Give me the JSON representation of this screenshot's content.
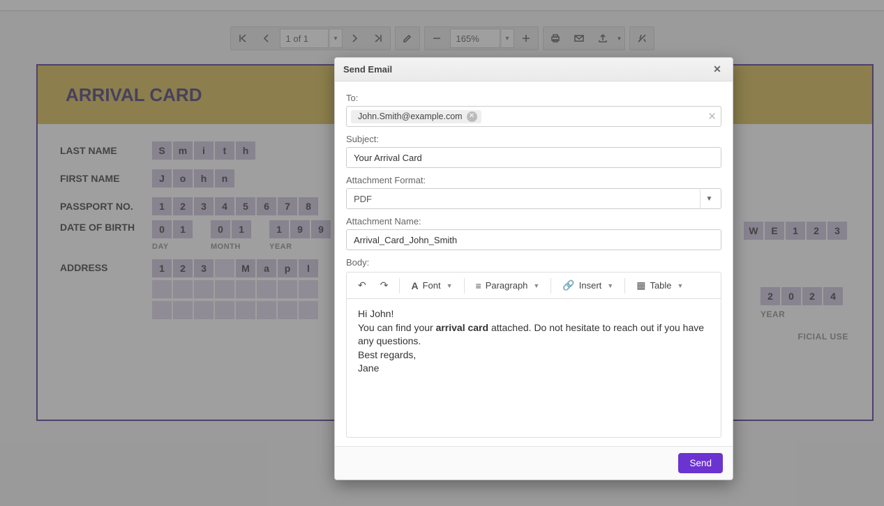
{
  "toolbar": {
    "page_text": "1 of 1",
    "zoom_text": "165%"
  },
  "document": {
    "title": "ARRIVAL CARD",
    "labels": {
      "last_name": "LAST NAME",
      "first_name": "FIRST NAME",
      "passport": "PASSPORT NO.",
      "dob": "DATE OF BIRTH",
      "address": "ADDRESS",
      "day": "DAY",
      "month": "MONTH",
      "year": "YEAR",
      "official": "FICIAL USE"
    },
    "fields": {
      "last_name": [
        "S",
        "m",
        "i",
        "t",
        "h"
      ],
      "first_name": [
        "J",
        "o",
        "h",
        "n"
      ],
      "passport": [
        "1",
        "2",
        "3",
        "4",
        "5",
        "6",
        "7",
        "8"
      ],
      "dob_day": [
        "0",
        "1"
      ],
      "dob_month": [
        "0",
        "1"
      ],
      "dob_year": [
        "1",
        "9",
        "9"
      ],
      "address1": [
        "1",
        "2",
        "3",
        "",
        "M",
        "a",
        "p",
        "l"
      ],
      "address2_blank_count": 8,
      "right1": [
        "W",
        "E",
        "1",
        "2",
        "3"
      ],
      "bottom_right_year": [
        "2",
        "0",
        "2",
        "4"
      ]
    }
  },
  "dialog": {
    "title": "Send Email",
    "labels": {
      "to": "To:",
      "subject": "Subject:",
      "format": "Attachment Format:",
      "att_name": "Attachment Name:",
      "body": "Body:"
    },
    "to_chip": "John.Smith@example.com",
    "subject": "Your Arrival Card",
    "format": "PDF",
    "attachment_name": "Arrival_Card_John_Smith",
    "editor_toolbar": {
      "font": "Font",
      "paragraph": "Paragraph",
      "insert": "Insert",
      "table": "Table"
    },
    "body_lines": {
      "l1": "Hi John!",
      "l2a": "You can find your ",
      "l2b": "arrival card",
      "l2c": " attached. Do not hesitate to reach out if you have any questions.",
      "l3": "Best regards,",
      "l4": "Jane"
    },
    "send": "Send"
  }
}
